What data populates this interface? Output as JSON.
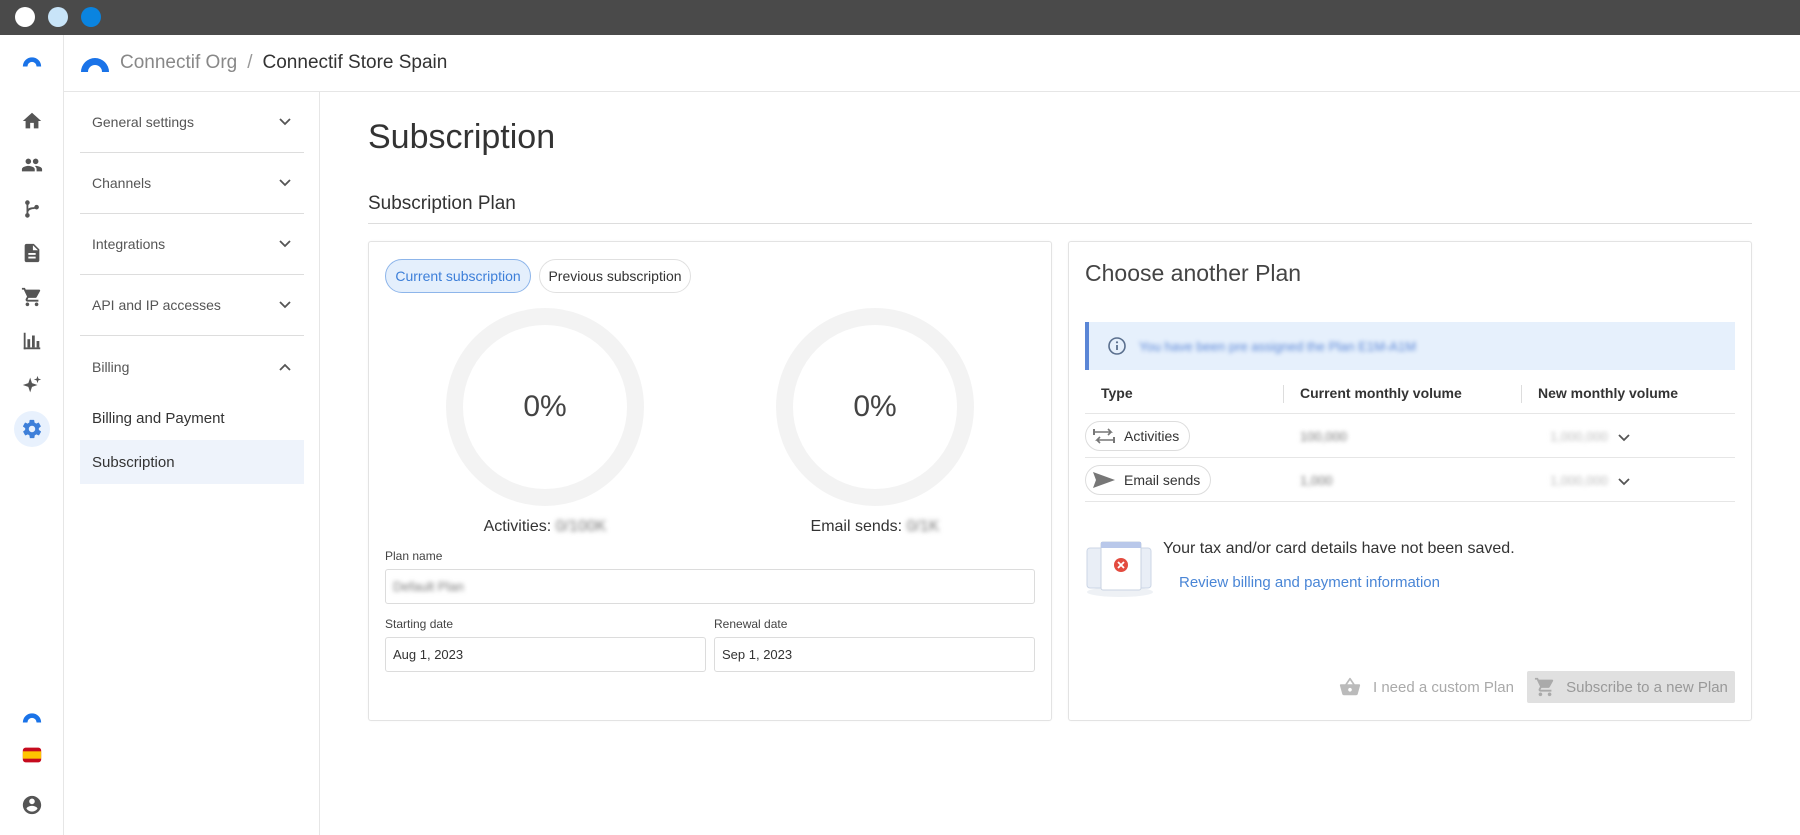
{
  "header": {
    "org": "Connectif Org",
    "separator": "/",
    "store": "Connectif Store Spain"
  },
  "rail": {
    "icons": [
      "logo-icon",
      "home-icon",
      "people-icon",
      "workflow-icon",
      "document-icon",
      "cart-icon",
      "chart-icon",
      "sparkle-icon",
      "gear-icon",
      "logo-icon",
      "spain-flag-icon",
      "account-icon"
    ],
    "active": "gear-icon"
  },
  "settings_menu": {
    "groups": [
      {
        "label": "General settings",
        "expanded": false
      },
      {
        "label": "Channels",
        "expanded": false
      },
      {
        "label": "Integrations",
        "expanded": false
      },
      {
        "label": "API and IP accesses",
        "expanded": false
      },
      {
        "label": "Billing",
        "expanded": true
      }
    ],
    "billing_items": [
      {
        "label": "Billing and Payment",
        "active": false
      },
      {
        "label": "Subscription",
        "active": true
      }
    ]
  },
  "page": {
    "title": "Subscription",
    "section_title": "Subscription Plan"
  },
  "subscription": {
    "tabs": [
      {
        "label": "Current subscription",
        "active": true
      },
      {
        "label": "Previous subscription",
        "active": false
      }
    ],
    "gauges": [
      {
        "percent": "0%",
        "label": "Activities:",
        "value": "0/100K"
      },
      {
        "percent": "0%",
        "label": "Email sends:",
        "value": "0/1K"
      }
    ],
    "plan_name_label": "Plan name",
    "plan_name_value": "Default Plan",
    "starting_date_label": "Starting date",
    "starting_date_value": "Aug 1, 2023",
    "renewal_date_label": "Renewal date",
    "renewal_date_value": "Sep 1, 2023"
  },
  "choose_plan": {
    "title": "Choose another Plan",
    "info": "You have been pre assigned the Plan E1M-A1M",
    "columns": [
      "Type",
      "Current monthly volume",
      "New monthly volume"
    ],
    "rows": [
      {
        "type": "Activities",
        "icon": "arrows-icon",
        "current": "100,000",
        "new": "1,000,000"
      },
      {
        "type": "Email sends",
        "icon": "send-icon",
        "current": "1,000",
        "new": "1,000,000"
      }
    ],
    "warning_text": "Your tax and/or card details have not been saved.",
    "warning_link": "Review billing and payment information",
    "custom_plan_label": "I need a custom Plan",
    "subscribe_label": "Subscribe to a new Plan"
  }
}
